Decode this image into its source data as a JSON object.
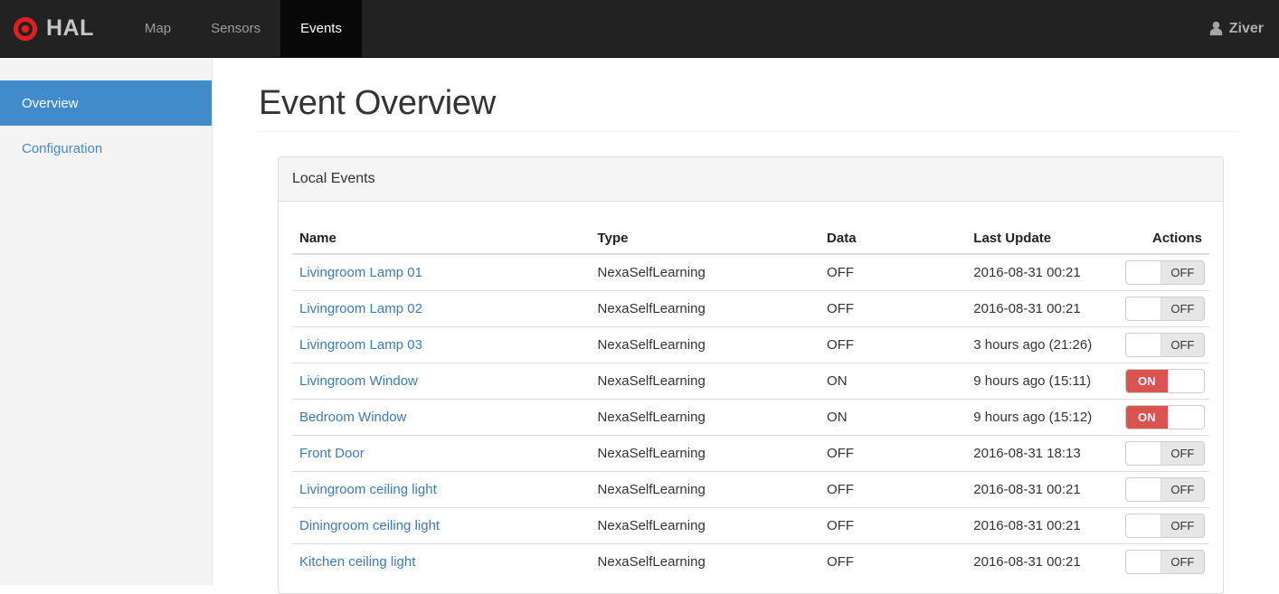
{
  "navbar": {
    "brand": "HAL",
    "items": [
      {
        "label": "Map",
        "active": false
      },
      {
        "label": "Sensors",
        "active": false
      },
      {
        "label": "Events",
        "active": true
      }
    ],
    "user": "Ziver"
  },
  "sidebar": {
    "items": [
      {
        "label": "Overview",
        "active": true
      },
      {
        "label": "Configuration",
        "active": false
      }
    ]
  },
  "main": {
    "title": "Event Overview",
    "panel": {
      "title": "Local Events",
      "table": {
        "columns": [
          "Name",
          "Type",
          "Data",
          "Last Update",
          "Actions"
        ],
        "rows": [
          {
            "name": "Livingroom Lamp 01",
            "type": "NexaSelfLearning",
            "data": "OFF",
            "last_update": "2016-08-31 00:21",
            "toggle": "OFF"
          },
          {
            "name": "Livingroom Lamp 02",
            "type": "NexaSelfLearning",
            "data": "OFF",
            "last_update": "2016-08-31 00:21",
            "toggle": "OFF"
          },
          {
            "name": "Livingroom Lamp 03",
            "type": "NexaSelfLearning",
            "data": "OFF",
            "last_update": "3 hours ago (21:26)",
            "toggle": "OFF"
          },
          {
            "name": "Livingroom Window",
            "type": "NexaSelfLearning",
            "data": "ON",
            "last_update": "9 hours ago (15:11)",
            "toggle": "ON"
          },
          {
            "name": "Bedroom Window",
            "type": "NexaSelfLearning",
            "data": "ON",
            "last_update": "9 hours ago (15:12)",
            "toggle": "ON"
          },
          {
            "name": "Front Door",
            "type": "NexaSelfLearning",
            "data": "OFF",
            "last_update": "2016-08-31 18:13",
            "toggle": "OFF"
          },
          {
            "name": "Livingroom ceiling light",
            "type": "NexaSelfLearning",
            "data": "OFF",
            "last_update": "2016-08-31 00:21",
            "toggle": "OFF"
          },
          {
            "name": "Diningroom ceiling light",
            "type": "NexaSelfLearning",
            "data": "OFF",
            "last_update": "2016-08-31 00:21",
            "toggle": "OFF"
          },
          {
            "name": "Kitchen ceiling light",
            "type": "NexaSelfLearning",
            "data": "OFF",
            "last_update": "2016-08-31 00:21",
            "toggle": "OFF"
          }
        ]
      }
    }
  },
  "colors": {
    "accent": "#428bca",
    "danger": "#d9534f",
    "link": "#3d7ab5",
    "navbar": "#222222",
    "logo_red": "#e02020"
  }
}
